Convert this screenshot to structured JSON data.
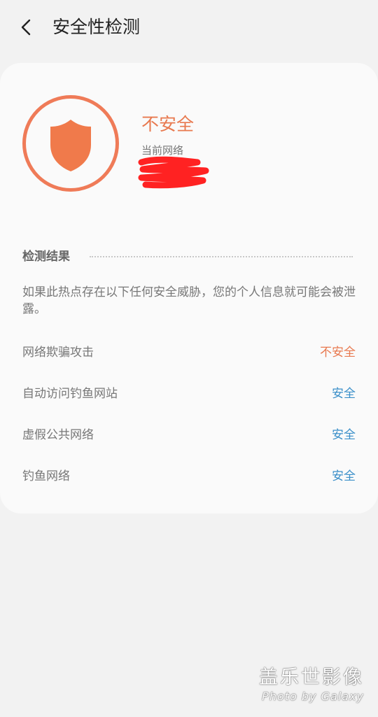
{
  "header": {
    "title": "安全性检测"
  },
  "status": {
    "label": "不安全",
    "network_label": "当前网络"
  },
  "results": {
    "title": "检测结果",
    "description": "如果此热点存在以下任何安全威胁，您的个人信息就可能会被泄露。",
    "items": [
      {
        "label": "网络欺骗攻击",
        "status": "不安全"
      },
      {
        "label": "自动访问钓鱼网站",
        "status": "安全"
      },
      {
        "label": "虚假公共网络",
        "status": "安全"
      },
      {
        "label": "钓鱼网络",
        "status": "安全"
      }
    ]
  },
  "colors": {
    "accent_unsafe": "#e8794f",
    "accent_safe": "#3a8fc9",
    "shield": "#f07a4b"
  },
  "icons": {
    "back": "back-arrow-icon",
    "shield": "shield-icon"
  },
  "watermark": {
    "line1": "盖乐世影像",
    "line2": "Photo by Galaxy"
  }
}
